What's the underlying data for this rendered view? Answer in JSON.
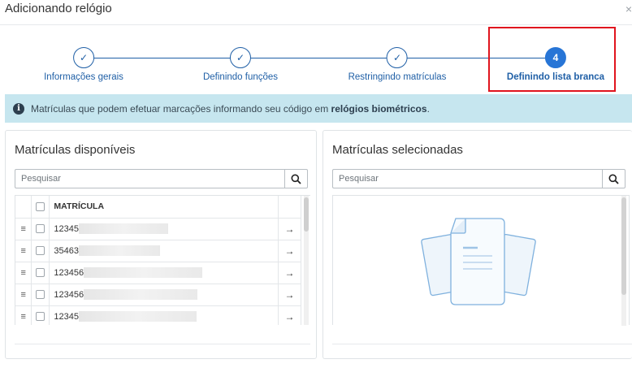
{
  "modal": {
    "title": "Adicionando relógio",
    "close_glyph": "×"
  },
  "stepper": {
    "steps": [
      {
        "number": "",
        "label": "Informações gerais",
        "state": "done"
      },
      {
        "number": "",
        "label": "Definindo funções",
        "state": "done"
      },
      {
        "number": "",
        "label": "Restringindo matrículas",
        "state": "done"
      },
      {
        "number": "4",
        "label": "Definindo lista branca",
        "state": "active"
      }
    ],
    "check_glyph": "✓"
  },
  "info": {
    "icon_text": "i",
    "text_before": "Matrículas que podem efetuar marcações informando seu código em ",
    "text_bold": "relógios biométricos",
    "text_after": "."
  },
  "available": {
    "title": "Matrículas disponíveis",
    "search_placeholder": "Pesquisar",
    "column_header": "MATRÍCULA",
    "rows": [
      {
        "prefix": "12345"
      },
      {
        "prefix": "35463"
      },
      {
        "prefix": "123456"
      },
      {
        "prefix": "123456"
      },
      {
        "prefix": "12345"
      }
    ],
    "drag_glyph": "≡",
    "move_glyph": "→"
  },
  "selected": {
    "title": "Matrículas selecionadas",
    "search_placeholder": "Pesquisar"
  },
  "colors": {
    "accent": "#2775d6",
    "step_line": "#1f5fa6",
    "highlight": "#e0141e",
    "info_bg": "#c6e6ef"
  }
}
